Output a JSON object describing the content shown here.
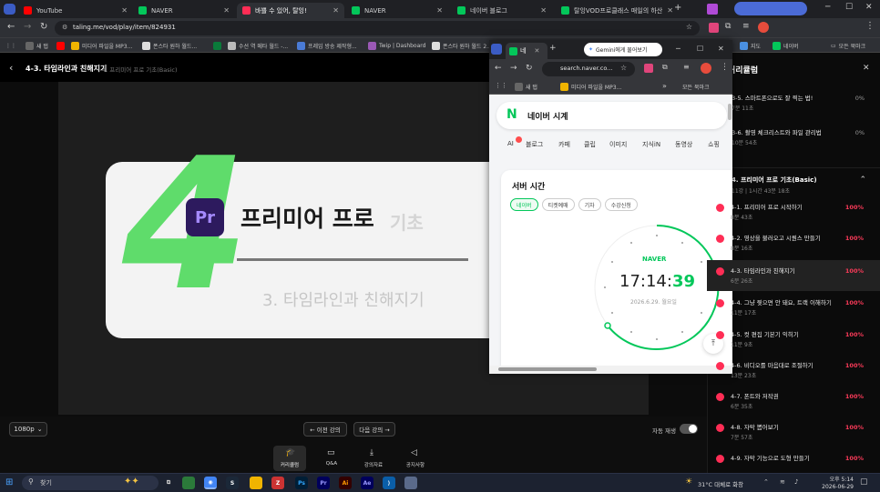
{
  "browser": {
    "tabs": [
      {
        "label": "YouTube",
        "color": "#ff0000"
      },
      {
        "label": "NAVER",
        "color": "#03c75a"
      },
      {
        "label": "바쁠 수 있어, 탈잉!",
        "color": "#ff2d55",
        "active": true
      },
      {
        "label": "NAVER",
        "color": "#03c75a"
      },
      {
        "label": "네이버 블로그",
        "color": "#03c75a"
      },
      {
        "label": "탈잉VOD프로클래스 매일의 하산",
        "color": "#03c75a"
      }
    ],
    "new_tab": "+",
    "address": "taling.me/vod/play/item/824931",
    "profile_tab": "",
    "bookmarks": [
      "새 탭",
      "",
      "미디어 파일을 MP3...",
      "폰스타 원하 월드...",
      "",
      "수선 역 메타 월드 -...",
      "프레임 방송 제작형...",
      "Twip | Dashboard",
      "폰스타 원하 월드 2...",
      "지도",
      "네이버",
      "모든 북마크"
    ]
  },
  "player": {
    "back_icon": "chevron-left-icon",
    "title": "4-3. 타임라인과 친해지기",
    "subtitle": "4. 프리미어 프로 기초(Basic)",
    "slide": {
      "big_number": "4",
      "logo_text": "Pr",
      "heading_main": "프리미어 프로",
      "heading_faded": "기초",
      "lesson": "3. 타임라인과 친해지기"
    },
    "quality": "1080p",
    "prev_label": "← 이전 강의",
    "next_label": "다음 강의 →",
    "autoplay_label": "자동 재생",
    "actions": [
      {
        "label": "커리큘럼",
        "icon": "graduation-cap-icon"
      },
      {
        "label": "Q&A",
        "icon": "chat-icon"
      },
      {
        "label": "강의자료",
        "icon": "download-icon"
      },
      {
        "label": "공지사항",
        "icon": "megaphone-icon"
      }
    ]
  },
  "curriculum": {
    "header": "커리큘럼",
    "close_icon": "close-icon",
    "section_title": "4. 프리미어 프로 기초(Basic)",
    "section_meta": "11강 | 1시간 43분 18초",
    "items_top": [
      {
        "title": "3-5. 스마트폰으로도 잘 찍는 법!",
        "duration": "7분 11초",
        "progress": "0%"
      },
      {
        "title": "3-6. 촬영 체크리스트와 파일 관리법",
        "duration": "10분 54초",
        "progress": "0%"
      }
    ],
    "items": [
      {
        "title": "4-1. 프리미어 프로 시작하기",
        "duration": "8분 43초",
        "progress": "100%"
      },
      {
        "title": "4-2. 영상을 불러오고 시퀀스 만들기",
        "duration": "8분 16초",
        "progress": "100%"
      },
      {
        "title": "4-3. 타임라인과 친해지기",
        "duration": "6분 26초",
        "progress": "100%",
        "active": true
      },
      {
        "title": "4-4. 그냥 찢으면 안 돼요, 트랙 이해하기",
        "duration": "11분 17초",
        "progress": "100%"
      },
      {
        "title": "4-5. 컷 편집 기본기 익히기",
        "duration": "11분 9초",
        "progress": "100%"
      },
      {
        "title": "4-6. 비디오를 마음대로 조절하기",
        "duration": "13분 23초",
        "progress": "100%"
      },
      {
        "title": "4-7. 폰트와 저작권",
        "duration": "6분 35초",
        "progress": "100%"
      },
      {
        "title": "4-8. 자막 뽑어보기",
        "duration": "7분 57초",
        "progress": "100%"
      },
      {
        "title": "4-9. 자막 기능으로 도형 만들기",
        "duration": "",
        "progress": "100%"
      }
    ]
  },
  "popup": {
    "tab_label": "네",
    "gemini": "Gemini에게 물어보기",
    "address": "search.naver.co...",
    "bookmarks": [
      "새 탭",
      "미디어 파일을 MP3...",
      "모든 북마크"
    ],
    "naver_title": "네이버 시계",
    "nav": [
      "AI",
      "블로그",
      "카페",
      "클립",
      "이미지",
      "지식iN",
      "동영상",
      "쇼핑"
    ],
    "card_title": "서버 시간",
    "chips": [
      "네이버",
      "티켓예매",
      "기차",
      "수강신청"
    ],
    "clock_brand": "NAVER",
    "time_hm": "17:14:",
    "time_s": "39",
    "date": "2026.6.29. 월요일",
    "colors": {
      "naver_green": "#03c75a"
    }
  },
  "taskbar": {
    "search": "찾기",
    "weather": "31°C 대체로 화창",
    "time": "오후 5:14",
    "date": "2026-06-29"
  }
}
